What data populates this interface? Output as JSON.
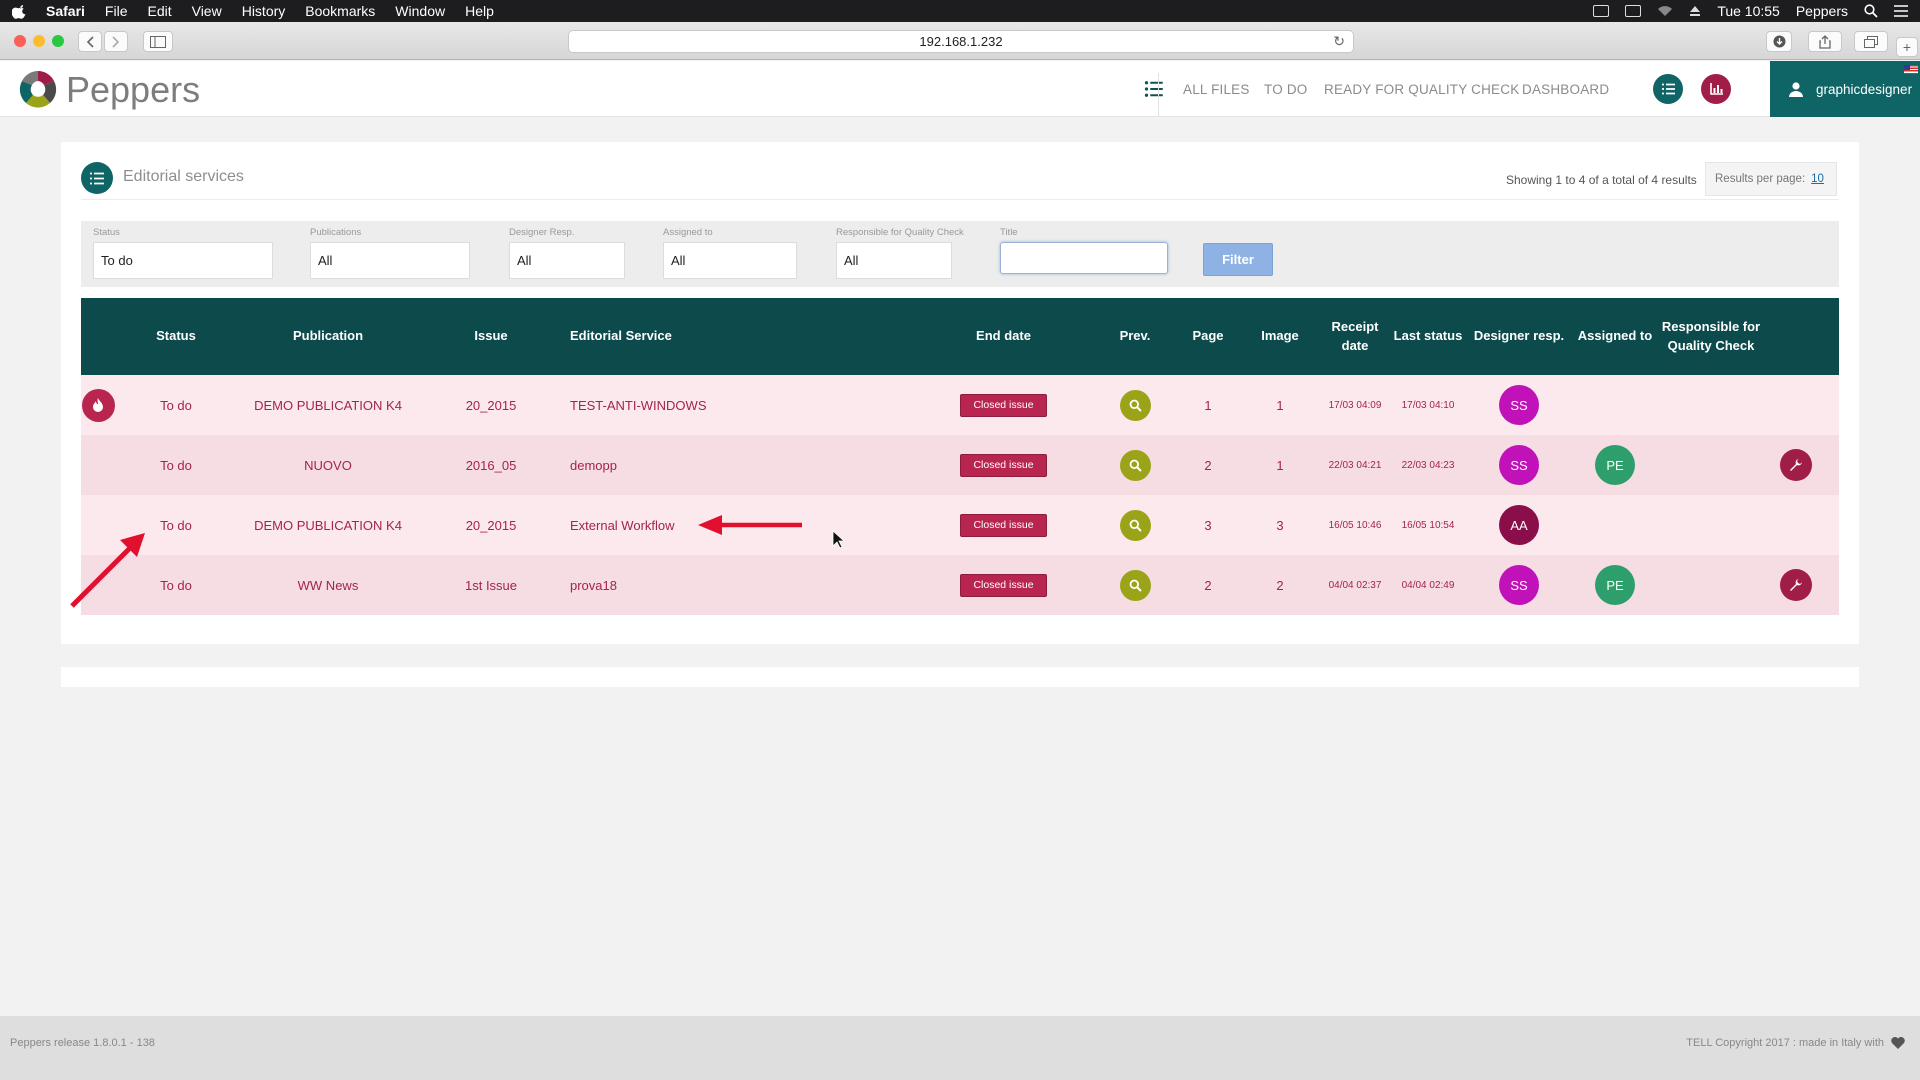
{
  "menubar": {
    "app_name": "Safari",
    "menus": [
      "File",
      "Edit",
      "View",
      "History",
      "Bookmarks",
      "Window",
      "Help"
    ],
    "clock": "Tue 10:55",
    "active_app": "Peppers"
  },
  "browser": {
    "url": "192.168.1.232"
  },
  "header": {
    "logo_text": "Peppers",
    "nav": [
      "ALL FILES",
      "TO DO",
      "READY FOR QUALITY CHECK",
      "DASHBOARD"
    ],
    "username": "graphicdesigner",
    "colors": {
      "teal": "#0f6466",
      "crimson": "#a01d47"
    }
  },
  "panel": {
    "title": "Editorial services",
    "showing": "Showing 1 to 4 of a total of 4 results",
    "results_per_page_label": "Results per page:",
    "results_per_page_value": "10"
  },
  "filters": {
    "status": {
      "label": "Status",
      "value": "To do"
    },
    "publications": {
      "label": "Publications",
      "value": "All"
    },
    "designer": {
      "label": "Designer Resp.",
      "value": "All"
    },
    "assigned": {
      "label": "Assigned to",
      "value": "All"
    },
    "quality": {
      "label": "Responsible for Quality Check",
      "value": "All"
    },
    "title": {
      "label": "Title",
      "value": ""
    },
    "filter_button": "Filter"
  },
  "table": {
    "headers": {
      "status": "Status",
      "publication": "Publication",
      "issue": "Issue",
      "service": "Editorial Service",
      "end_date": "End date",
      "prev": "Prev.",
      "page": "Page",
      "image": "Image",
      "receipt_date": "Receipt date",
      "last_status": "Last status",
      "designer": "Designer resp.",
      "assigned": "Assigned to",
      "quality": "Responsible for Quality Check"
    },
    "rows": [
      {
        "status": "To do",
        "publication": "DEMO PUBLICATION K4",
        "issue": "20_2015",
        "service": "TEST-ANTI-WINDOWS",
        "end_date": "Closed issue",
        "page": "1",
        "image": "1",
        "receipt": "17/03 04:09",
        "last_status": "17/03 04:10",
        "designer": "SS",
        "assigned": "",
        "quality": ""
      },
      {
        "status": "To do",
        "publication": "NUOVO",
        "issue": "2016_05",
        "service": "demopp",
        "end_date": "Closed issue",
        "page": "2",
        "image": "1",
        "receipt": "22/03 04:21",
        "last_status": "22/03 04:23",
        "designer": "SS",
        "assigned": "PE",
        "quality": ""
      },
      {
        "status": "To do",
        "publication": "DEMO PUBLICATION K4",
        "issue": "20_2015",
        "service": "External Workflow",
        "end_date": "Closed issue",
        "page": "3",
        "image": "3",
        "receipt": "16/05 10:46",
        "last_status": "16/05 10:54",
        "designer": "AA",
        "assigned": "",
        "quality": ""
      },
      {
        "status": "To do",
        "publication": "WW News",
        "issue": "1st Issue",
        "service": "prova18",
        "end_date": "Closed issue",
        "page": "2",
        "image": "2",
        "receipt": "04/04 02:37",
        "last_status": "04/04 02:49",
        "designer": "SS",
        "assigned": "PE",
        "quality": ""
      }
    ],
    "avatar_colors": {
      "SS": "#c012b8",
      "AA": "#8a0e4a",
      "PE": "#2e9e6c"
    }
  },
  "footer": {
    "release": "Peppers release 1.8.0.1 - 138",
    "copyright": "TELL Copyright 2017 : made in Italy with"
  },
  "icons": [
    "apple-icon",
    "search-icon",
    "list-icon",
    "chart-icon",
    "user-icon",
    "flame-icon",
    "magnifier-icon",
    "wrench-icon",
    "heart-icon"
  ]
}
